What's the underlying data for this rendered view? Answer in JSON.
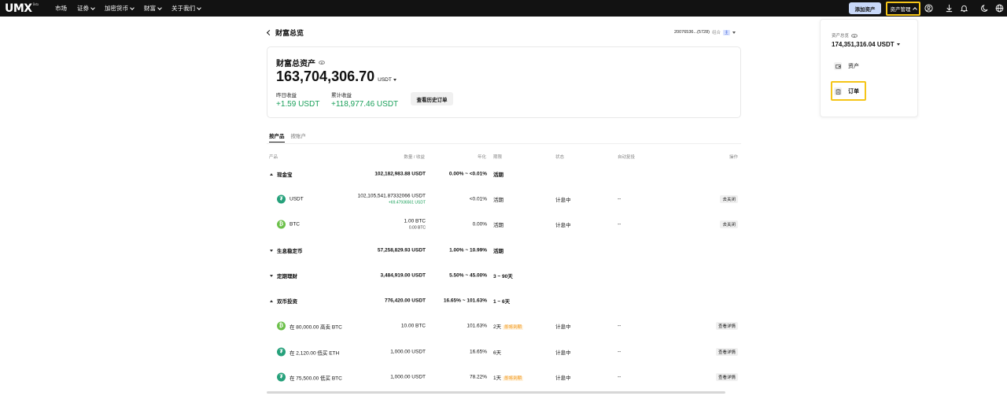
{
  "nav": {
    "logo": "UMX",
    "logo_sup": "Beta",
    "items": [
      {
        "label": "市场",
        "has_menu": false
      },
      {
        "label": "证券",
        "has_menu": true
      },
      {
        "label": "加密货币",
        "has_menu": true
      },
      {
        "label": "财富",
        "has_menu": true
      },
      {
        "label": "关于我们",
        "has_menu": true
      }
    ],
    "add_asset": "添加资产",
    "asset_mgmt": "资产管理",
    "icons": [
      "user-icon",
      "download-icon",
      "bell-icon",
      "moon-icon",
      "globe-icon"
    ]
  },
  "page": {
    "title": "财富总览",
    "account": "20076536...(5728)",
    "account_tag": "组合",
    "account_badge": "主"
  },
  "summary": {
    "label": "财富总资产",
    "total": "163,704,306.70",
    "unit": "USDT",
    "yesterday_label": "昨日收益",
    "yesterday_value": "+1.59 USDT",
    "cumulative_label": "累计收益",
    "cumulative_value": "+118,977.46 USDT",
    "history_button": "查看历史订单"
  },
  "tabs": [
    "按产品",
    "按账户"
  ],
  "table": {
    "headers": {
      "product": "产品",
      "amount": "数量 / 收益",
      "apy": "年化",
      "term": "期限",
      "status": "状态",
      "auto": "自动复投",
      "action": "操作"
    },
    "rows": [
      {
        "kind": "group",
        "expanded": true,
        "name": "现金宝",
        "amount": "102,182,983.88 USDT",
        "apy": "0.00% ~ <0.01%",
        "term": "活期"
      },
      {
        "kind": "item",
        "coin": "usdt",
        "coin_glyph": "₮",
        "name": "USDT",
        "amount": "102,105,541.87332066 USDT",
        "sub": "+69.47936561 USDT",
        "sub_color": "green",
        "apy": "<0.01%",
        "term": "活期",
        "status": "计息中",
        "auto": "--",
        "action": "去关闭"
      },
      {
        "kind": "item",
        "coin": "btc",
        "coin_glyph": "₿",
        "name": "BTC",
        "amount": "1.00 BTC",
        "sub": "0.00 BTC",
        "sub_color": "grey",
        "apy": "0.00%",
        "term": "活期",
        "status": "计息中",
        "auto": "--",
        "action": "去关闭"
      },
      {
        "kind": "group",
        "expanded": false,
        "name": "生息稳定币",
        "amount": "57,258,829.93 USDT",
        "apy": "1.00% ~ 10.99%",
        "term": "活期"
      },
      {
        "kind": "group",
        "expanded": false,
        "name": "定期理财",
        "amount": "3,484,919.00 USDT",
        "apy": "5.50% ~ 45.00%",
        "term": "3 ~ 90天"
      },
      {
        "kind": "group",
        "expanded": true,
        "name": "双币投资",
        "amount": "776,420.00 USDT",
        "apy": "16.65% ~ 101.63%",
        "term": "1 ~ 6天"
      },
      {
        "kind": "item",
        "coin": "btc",
        "coin_glyph": "₿",
        "name": "在 80,000.00 高卖 BTC",
        "amount": "10.00 BTC",
        "apy": "101.63%",
        "term": "2天",
        "soon": "即将到期",
        "status": "计息中",
        "auto": "--",
        "action": "查看详情"
      },
      {
        "kind": "item",
        "coin": "usdt",
        "coin_glyph": "₮",
        "name": "在 2,120.00 低买 ETH",
        "amount": "1,000.00 USDT",
        "apy": "16.65%",
        "term": "6天",
        "status": "计息中",
        "auto": "--",
        "action": "查看详情"
      },
      {
        "kind": "item",
        "coin": "usdt",
        "coin_glyph": "₮",
        "name": "在 75,500.00 低买 BTC",
        "amount": "1,000.00 USDT",
        "apy": "78.22%",
        "term": "1天",
        "soon": "即将到期",
        "status": "计息中",
        "auto": "--",
        "action": "查看详情"
      }
    ]
  },
  "dropdown": {
    "label": "资产总览",
    "total": "174,351,316.04 USDT",
    "items": [
      {
        "label": "资产",
        "icon": "wallet-icon"
      },
      {
        "label": "订单",
        "icon": "clipboard-icon"
      }
    ]
  },
  "colors": {
    "positive": "#1aa05a",
    "highlight": "#f5c518",
    "soon": "#f0900a"
  }
}
